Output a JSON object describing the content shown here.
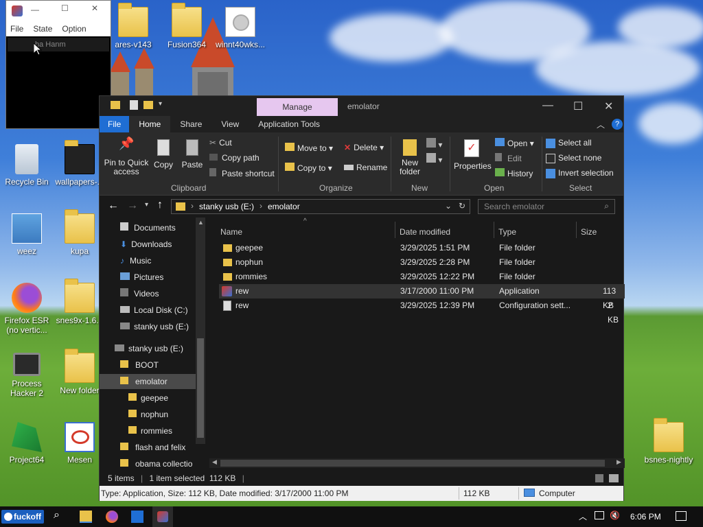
{
  "desktop": {
    "icons": [
      {
        "label": "ares-v143"
      },
      {
        "label": "Fusion364"
      },
      {
        "label": "winnt40wks..."
      },
      {
        "label": "Recycle Bin"
      },
      {
        "label": "wallpapers-..."
      },
      {
        "label": "weez"
      },
      {
        "label": "kupa"
      },
      {
        "label": "Firefox ESR (no vertic..."
      },
      {
        "label": "snes9x-1.6..."
      },
      {
        "label": "Process Hacker 2"
      },
      {
        "label": "New folder"
      },
      {
        "label": "Project64"
      },
      {
        "label": "Mesen"
      },
      {
        "label": "bsnes-nightly"
      }
    ]
  },
  "mini_app": {
    "menu": [
      "File",
      "State",
      "Option"
    ],
    "list_item": "ha Hanm"
  },
  "explorer": {
    "manage_tab": "Manage",
    "title": "emolator",
    "tabs": [
      "File",
      "Home",
      "Share",
      "View",
      "Application Tools"
    ],
    "ribbon": {
      "clipboard": {
        "pin": "Pin to Quick access",
        "copy": "Copy",
        "paste": "Paste",
        "cut": "Cut",
        "copy_path": "Copy path",
        "paste_shortcut": "Paste shortcut",
        "group": "Clipboard"
      },
      "organize": {
        "move_to": "Move to",
        "copy_to": "Copy to",
        "delete": "Delete",
        "rename": "Rename",
        "group": "Organize"
      },
      "new": {
        "new_folder": "New folder",
        "group": "New"
      },
      "open": {
        "properties": "Properties",
        "open": "Open",
        "edit": "Edit",
        "history": "History",
        "group": "Open"
      },
      "select": {
        "select_all": "Select all",
        "select_none": "Select none",
        "invert": "Invert selection",
        "group": "Select"
      }
    },
    "address": {
      "drive": "stanky usb (E:)",
      "folder": "emolator",
      "search_placeholder": "Search emolator"
    },
    "nav": [
      "Documents",
      "Downloads",
      "Music",
      "Pictures",
      "Videos",
      "Local Disk (C:)",
      "stanky usb (E:)",
      "stanky usb (E:)",
      "BOOT",
      "emolator",
      "geepee",
      "nophun",
      "rommies",
      "flash and felix",
      "obama collectio"
    ],
    "columns": [
      "Name",
      "Date modified",
      "Type",
      "Size"
    ],
    "files": [
      {
        "name": "geepee",
        "date": "3/29/2025 1:51 PM",
        "type": "File folder",
        "size": ""
      },
      {
        "name": "nophun",
        "date": "3/29/2025 2:28 PM",
        "type": "File folder",
        "size": ""
      },
      {
        "name": "rommies",
        "date": "3/29/2025 12:22 PM",
        "type": "File folder",
        "size": ""
      },
      {
        "name": "rew",
        "date": "3/17/2000 11:00 PM",
        "type": "Application",
        "size": "113 KB"
      },
      {
        "name": "rew",
        "date": "3/29/2025 12:39 PM",
        "type": "Configuration sett...",
        "size": "2 KB"
      }
    ],
    "status": {
      "items": "5 items",
      "selected": "1 item selected  112 KB"
    },
    "info": {
      "details": "Type: Application, Size: 112 KB, Date modified: 3/17/2000 11:00 PM",
      "size": "112 KB",
      "location": "Computer"
    }
  },
  "taskbar": {
    "start_label": "fuckoff",
    "clock": "6:06 PM"
  }
}
